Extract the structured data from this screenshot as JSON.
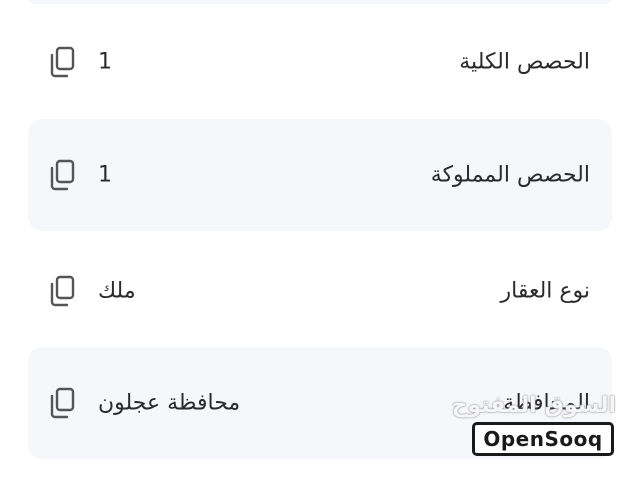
{
  "details": {
    "rows": [
      {
        "label": "الحصص الكلية",
        "value": "1"
      },
      {
        "label": "الحصص المملوكة",
        "value": "1"
      },
      {
        "label": "نوع العقار",
        "value": "ملك"
      },
      {
        "label": "المحافظة",
        "value": "محافظة عجلون"
      }
    ],
    "copy_icon": "copy-icon"
  },
  "watermark": {
    "arabic": "السوق المفتوح",
    "brand": "OpenSooq"
  },
  "colors": {
    "row_alt_background": "#f5f7fa",
    "text": "#2b2b2b",
    "icon": "#555555"
  }
}
